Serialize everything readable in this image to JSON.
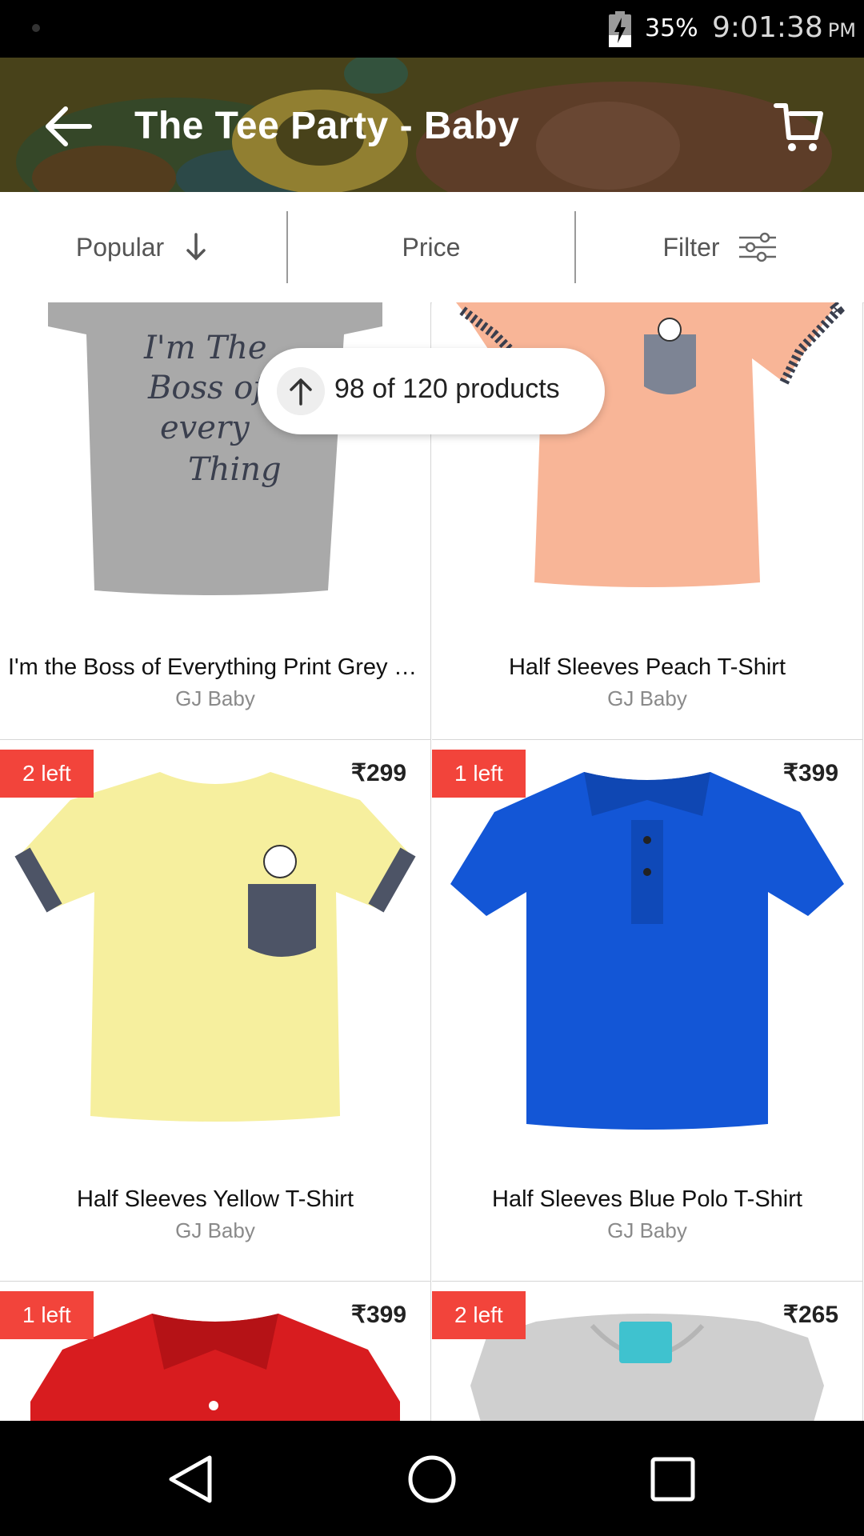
{
  "status_bar": {
    "battery": "35%",
    "time": "9:01:38",
    "ampm": "PM"
  },
  "app_bar": {
    "title": "The Tee Party - Baby"
  },
  "sort_bar": {
    "popular": "Popular",
    "price": "Price",
    "filter": "Filter"
  },
  "scroll_pill": {
    "text": "98 of 120 products"
  },
  "products": [
    {
      "name": "I'm the Boss of Everything Print Grey T-Shirt",
      "brand": "GJ Baby",
      "print_text": "I'm The Boss of every Thing"
    },
    {
      "name": "Half Sleeves Peach T-Shirt",
      "brand": "GJ Baby"
    },
    {
      "name": "Half Sleeves Yellow T-Shirt",
      "brand": "GJ Baby",
      "stock": "2 left",
      "price": "₹299"
    },
    {
      "name": "Half Sleeves Blue Polo T-Shirt",
      "brand": "GJ Baby",
      "stock": "1 left",
      "price": "₹399"
    },
    {
      "name": "",
      "brand": "",
      "stock": "1 left",
      "price": "₹399"
    },
    {
      "name": "",
      "brand": "",
      "stock": "2 left",
      "price": "₹265"
    }
  ],
  "colors": {
    "accent_badge": "#f2443b",
    "grey_tee": "#a9a9a9",
    "peach_tee": "#f8b597",
    "yellow_tee": "#f6ef9e",
    "blue_tee": "#1356d6",
    "red_tee": "#d81c1f"
  },
  "icons": [
    "back-arrow-icon",
    "cart-icon",
    "sort-down-arrow-icon",
    "filter-sliders-icon",
    "scroll-up-arrow-icon",
    "nav-back-icon",
    "nav-home-icon",
    "nav-recents-icon",
    "battery-charging-icon"
  ]
}
